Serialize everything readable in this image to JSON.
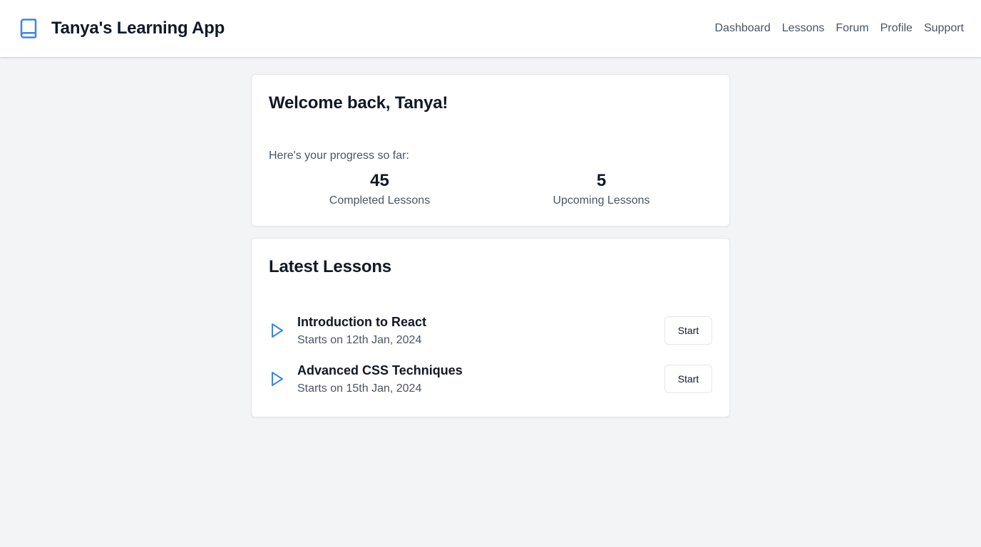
{
  "app": {
    "title": "Tanya's Learning App",
    "logo_icon": "book-icon",
    "accent_color": "#3b82f6"
  },
  "nav": {
    "items": [
      {
        "label": "Dashboard"
      },
      {
        "label": "Lessons"
      },
      {
        "label": "Forum"
      },
      {
        "label": "Profile"
      },
      {
        "label": "Support"
      }
    ]
  },
  "welcome": {
    "title": "Welcome back, Tanya!",
    "progress_text": "Here's your progress so far:",
    "stats": [
      {
        "value": "45",
        "label": "Completed Lessons"
      },
      {
        "value": "5",
        "label": "Upcoming Lessons"
      }
    ]
  },
  "latest_lessons": {
    "title": "Latest Lessons",
    "items": [
      {
        "icon": "play-icon",
        "title": "Introduction to React",
        "date": "Starts on 12th Jan, 2024",
        "button_label": "Start"
      },
      {
        "icon": "play-icon",
        "title": "Advanced CSS Techniques",
        "date": "Starts on 15th Jan, 2024",
        "button_label": "Start"
      }
    ]
  }
}
